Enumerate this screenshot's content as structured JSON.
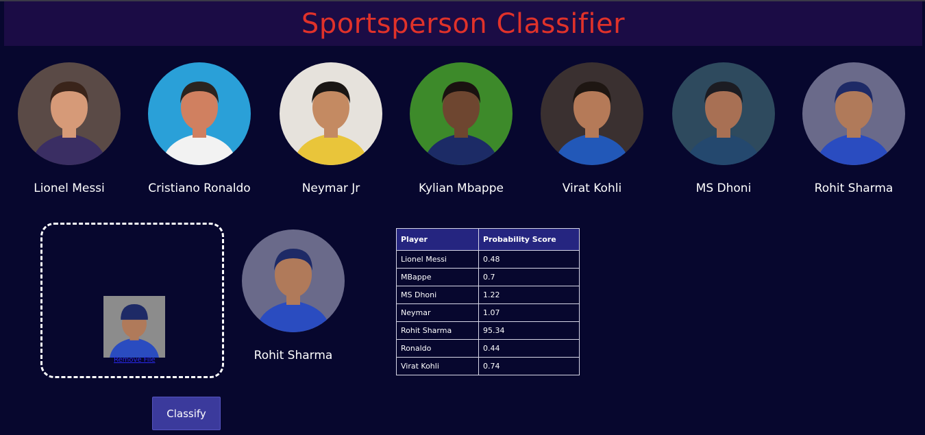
{
  "header": {
    "title": "Sportsperson Classifier"
  },
  "players": [
    {
      "name": "Lionel Messi",
      "icon": "player-photo-messi",
      "bg": "#5a4a46",
      "shirt": "#3a2e63",
      "skin": "#d69a78",
      "hair": "#3a241a"
    },
    {
      "name": "Cristiano Ronaldo",
      "icon": "player-photo-ronaldo",
      "bg": "#2aa0d8",
      "shirt": "#f2f2f2",
      "skin": "#d08060",
      "hair": "#2a2420"
    },
    {
      "name": "Neymar Jr",
      "icon": "player-photo-neymar",
      "bg": "#e6e2dc",
      "shirt": "#e9c53a",
      "skin": "#c48a62",
      "hair": "#1a1614"
    },
    {
      "name": "Kylian Mbappe",
      "icon": "player-photo-mbappe",
      "bg": "#3d8a2a",
      "shirt": "#1c2b66",
      "skin": "#6e4630",
      "hair": "#1a1210"
    },
    {
      "name": "Virat Kohli",
      "icon": "player-photo-kohli",
      "bg": "#3a3030",
      "shirt": "#2258b8",
      "skin": "#b57a58",
      "hair": "#1e1612"
    },
    {
      "name": "MS Dhoni",
      "icon": "player-photo-dhoni",
      "bg": "#2e4a5e",
      "shirt": "#24486e",
      "skin": "#a87054",
      "hair": "#1c1c22"
    },
    {
      "name": "Rohit Sharma",
      "icon": "player-photo-rohit",
      "bg": "#6a6a8a",
      "shirt": "#2a4cc0",
      "skin": "#b07a5a",
      "hair": "#1e2a66"
    }
  ],
  "upload": {
    "preview_icon": "uploaded-photo-rohit",
    "remove_label": "Remove File"
  },
  "classify": {
    "label": "Classify"
  },
  "result": {
    "name": "Rohit Sharma",
    "icon": "result-photo-rohit"
  },
  "scores": {
    "headers": [
      "Player",
      "Probability Score"
    ],
    "rows": [
      [
        "Lionel Messi",
        "0.48"
      ],
      [
        "MBappe",
        "0.7"
      ],
      [
        "MS Dhoni",
        "1.22"
      ],
      [
        "Neymar",
        "1.07"
      ],
      [
        "Rohit Sharma",
        "95.34"
      ],
      [
        "Ronaldo",
        "0.44"
      ],
      [
        "Virat Kohli",
        "0.74"
      ]
    ]
  }
}
